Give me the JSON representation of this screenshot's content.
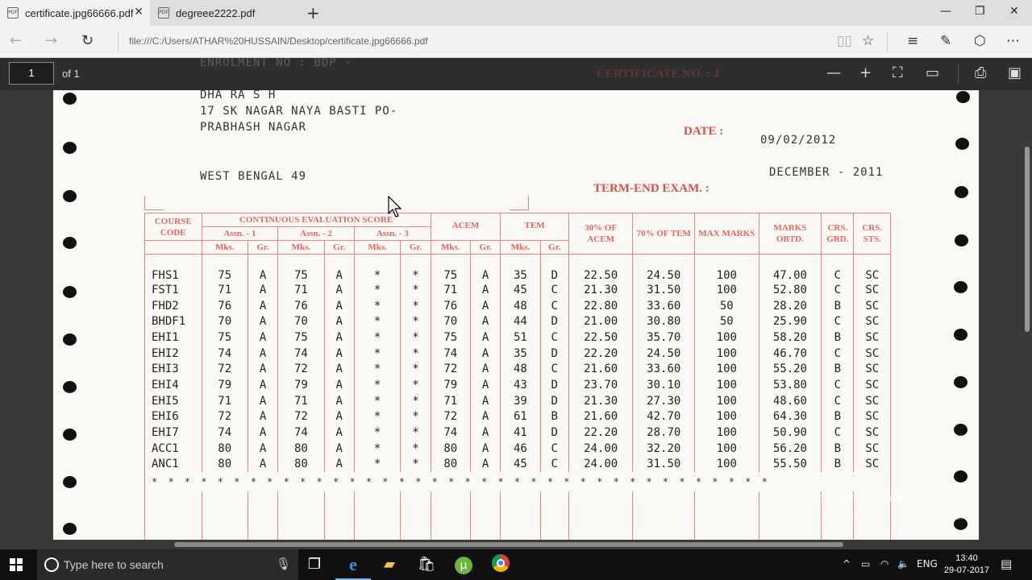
{
  "browser": {
    "tabs": [
      {
        "label": "certificate.jpg66666.pdf",
        "active": true
      },
      {
        "label": "degreee2222.pdf",
        "active": false
      }
    ],
    "url": "file:///C:/Users/ATHAR%20HUSSAIN/Desktop/certificate.jpg66666.pdf"
  },
  "pdf_toolbar": {
    "page_number": "1",
    "page_of": "of 1"
  },
  "document": {
    "faded_header_left": "ENROLMENT NO : BDP -",
    "faded_header_right": "CERTIFICATE NO. : J",
    "address_lines": [
      "DHA      RA     S    H",
      "17 SK NAGAR NAYA BASTI PO-",
      "PRABHASH NAGAR",
      "WEST BENGAL     49"
    ],
    "date_label": "DATE :",
    "date_value": "09/02/2012",
    "exam_label": "TERM-END EXAM. :",
    "exam_value": "DECEMBER - 2011",
    "table_headers": {
      "course_code": "COURSE CODE",
      "ces": "CONTINUOUS EVALUATION SCORE",
      "asn1": "Assn. - 1",
      "asn2": "Assn. - 2",
      "asn3": "Assn. - 3",
      "acem": "ACEM",
      "tem": "TEM",
      "pct30": "30% OF ACEM",
      "pct70": "70% OF TEM",
      "max": "MAX MARKS",
      "obtd": "MARKS OBTD.",
      "crs_grd": "CRS. GRD.",
      "crs_sts": "CRS. STS.",
      "mks": "Mks.",
      "gr": "Gr."
    },
    "rows": [
      [
        "FHS1",
        "75",
        "A",
        "75",
        "A",
        "*",
        "*",
        "75",
        "A",
        "35",
        "D",
        "22.50",
        "24.50",
        "100",
        "47.00",
        "C",
        "SC"
      ],
      [
        "FST1",
        "71",
        "A",
        "71",
        "A",
        "*",
        "*",
        "71",
        "A",
        "45",
        "C",
        "21.30",
        "31.50",
        "100",
        "52.80",
        "C",
        "SC"
      ],
      [
        "FHD2",
        "76",
        "A",
        "76",
        "A",
        "*",
        "*",
        "76",
        "A",
        "48",
        "C",
        "22.80",
        "33.60",
        "50",
        "28.20",
        "B",
        "SC"
      ],
      [
        "BHDF1",
        "70",
        "A",
        "70",
        "A",
        "*",
        "*",
        "70",
        "A",
        "44",
        "D",
        "21.00",
        "30.80",
        "50",
        "25.90",
        "C",
        "SC"
      ],
      [
        "EHI1",
        "75",
        "A",
        "75",
        "A",
        "*",
        "*",
        "75",
        "A",
        "51",
        "C",
        "22.50",
        "35.70",
        "100",
        "58.20",
        "B",
        "SC"
      ],
      [
        "EHI2",
        "74",
        "A",
        "74",
        "A",
        "*",
        "*",
        "74",
        "A",
        "35",
        "D",
        "22.20",
        "24.50",
        "100",
        "46.70",
        "C",
        "SC"
      ],
      [
        "EHI3",
        "72",
        "A",
        "72",
        "A",
        "*",
        "*",
        "72",
        "A",
        "48",
        "C",
        "21.60",
        "33.60",
        "100",
        "55.20",
        "B",
        "SC"
      ],
      [
        "EHI4",
        "79",
        "A",
        "79",
        "A",
        "*",
        "*",
        "79",
        "A",
        "43",
        "D",
        "23.70",
        "30.10",
        "100",
        "53.80",
        "C",
        "SC"
      ],
      [
        "EHI5",
        "71",
        "A",
        "71",
        "A",
        "*",
        "*",
        "71",
        "A",
        "39",
        "D",
        "21.30",
        "27.30",
        "100",
        "48.60",
        "C",
        "SC"
      ],
      [
        "EHI6",
        "72",
        "A",
        "72",
        "A",
        "*",
        "*",
        "72",
        "A",
        "61",
        "B",
        "21.60",
        "42.70",
        "100",
        "64.30",
        "B",
        "SC"
      ],
      [
        "EHI7",
        "74",
        "A",
        "74",
        "A",
        "*",
        "*",
        "74",
        "A",
        "41",
        "D",
        "22.20",
        "28.70",
        "100",
        "50.90",
        "C",
        "SC"
      ],
      [
        "ACC1",
        "80",
        "A",
        "80",
        "A",
        "*",
        "*",
        "80",
        "A",
        "46",
        "C",
        "24.00",
        "32.20",
        "100",
        "56.20",
        "B",
        "SC"
      ],
      [
        "ANC1",
        "80",
        "A",
        "80",
        "A",
        "*",
        "*",
        "80",
        "A",
        "45",
        "C",
        "24.00",
        "31.50",
        "100",
        "55.50",
        "B",
        "SC"
      ]
    ],
    "star_row": "* * * * * * * * * * * * * * * * * * * * * * * * * * * * * * * * * * * * * *"
  },
  "watermark": {
    "line1": "Activate Windows",
    "line2": "Go to Settings to activate Windows."
  },
  "taskbar": {
    "search_placeholder": "Type here to search",
    "language": "ENG",
    "time": "13:40",
    "date": "29-07-2017"
  }
}
